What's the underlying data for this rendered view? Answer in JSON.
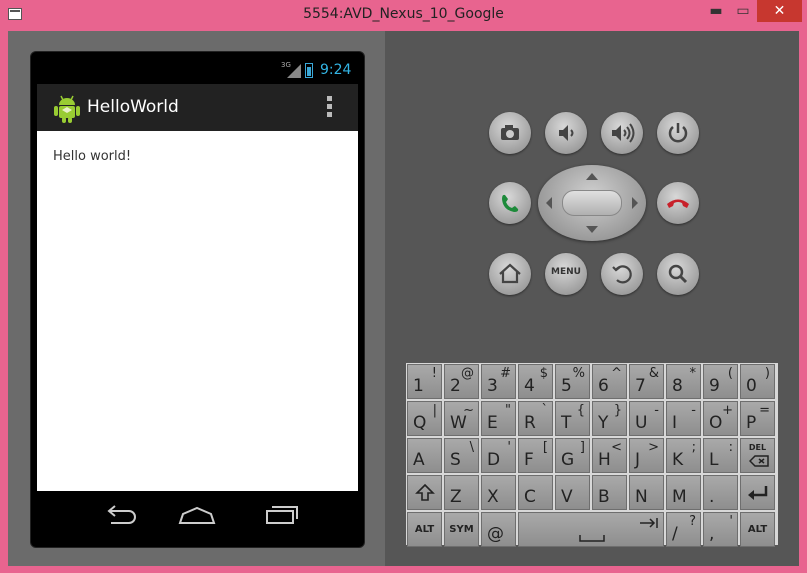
{
  "window": {
    "title": "5554:AVD_Nexus_10_Google",
    "minimize_label": "▬",
    "maximize_label": "▭",
    "close_label": "✕"
  },
  "phone": {
    "status": {
      "network": "3G",
      "time": "9:24"
    },
    "action_bar": {
      "title": "HelloWorld"
    },
    "content": {
      "text": "Hello world!"
    }
  },
  "controls": {
    "menu_label": "MENU",
    "buttons": [
      "camera",
      "volume-down",
      "volume-up",
      "power",
      "call",
      "dpad",
      "end-call",
      "home",
      "menu",
      "back",
      "search"
    ]
  },
  "keyboard": {
    "row1": [
      {
        "main": "1",
        "alt": "!"
      },
      {
        "main": "2",
        "alt": "@"
      },
      {
        "main": "3",
        "alt": "#"
      },
      {
        "main": "4",
        "alt": "$"
      },
      {
        "main": "5",
        "alt": "%"
      },
      {
        "main": "6",
        "alt": "^"
      },
      {
        "main": "7",
        "alt": "&"
      },
      {
        "main": "8",
        "alt": "*"
      },
      {
        "main": "9",
        "alt": "("
      },
      {
        "main": "0",
        "alt": ")"
      }
    ],
    "row2": [
      {
        "main": "Q",
        "alt": "|"
      },
      {
        "main": "W",
        "alt": "~"
      },
      {
        "main": "E",
        "alt": "\""
      },
      {
        "main": "R",
        "alt": "`"
      },
      {
        "main": "T",
        "alt": "{"
      },
      {
        "main": "Y",
        "alt": "}"
      },
      {
        "main": "U",
        "alt": "-"
      },
      {
        "main": "I",
        "alt": "-"
      },
      {
        "main": "O",
        "alt": "+"
      },
      {
        "main": "P",
        "alt": "="
      }
    ],
    "row3": [
      {
        "main": "A",
        "alt": ""
      },
      {
        "main": "S",
        "alt": "\\"
      },
      {
        "main": "D",
        "alt": "'"
      },
      {
        "main": "F",
        "alt": "["
      },
      {
        "main": "G",
        "alt": "]"
      },
      {
        "main": "H",
        "alt": "<"
      },
      {
        "main": "J",
        "alt": ">"
      },
      {
        "main": "K",
        "alt": ";"
      },
      {
        "main": "L",
        "alt": ":"
      }
    ],
    "del_label": "DEL",
    "row4": [
      {
        "main": "Z",
        "alt": ""
      },
      {
        "main": "X",
        "alt": ""
      },
      {
        "main": "C",
        "alt": ""
      },
      {
        "main": "V",
        "alt": ""
      },
      {
        "main": "B",
        "alt": ""
      },
      {
        "main": "N",
        "alt": ""
      },
      {
        "main": "M",
        "alt": ""
      },
      {
        "main": ".",
        "alt": ""
      }
    ],
    "alt_label": "ALT",
    "sym_label": "SYM",
    "at_label": "@",
    "slash_main": "/",
    "slash_alt": "?",
    "comma_main": ",",
    "comma_alt": "'"
  }
}
